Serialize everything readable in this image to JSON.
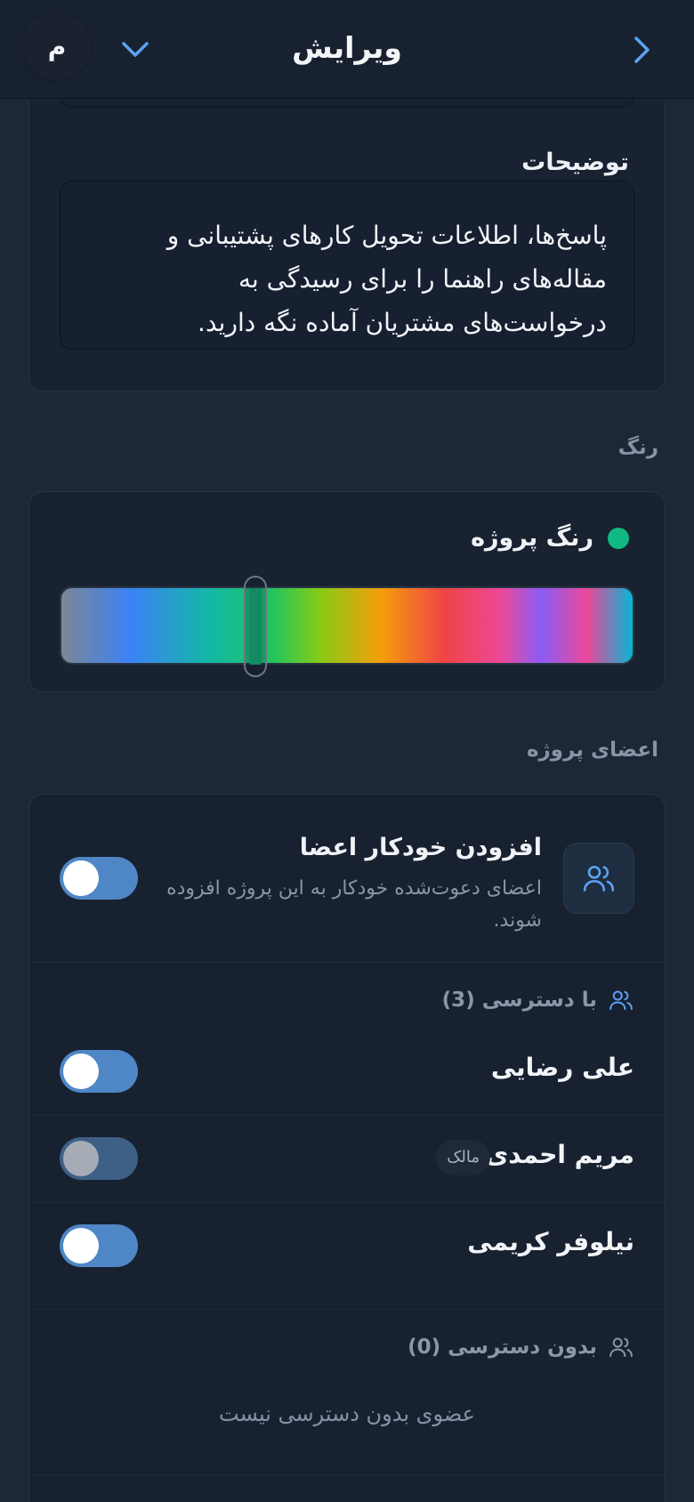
{
  "header": {
    "title": "ویرایش",
    "avatar_initial": "م"
  },
  "description": {
    "label": "توضیحات",
    "lines": [
      "پاسخ‌ها، اطلاعات تحویل کارهای پشتیبانی و",
      "مقاله‌های راهنما را برای رسیدگی به",
      "درخواست‌های مشتریان آماده نگه دارید."
    ]
  },
  "color_section": {
    "label": "رنگ",
    "title": "رنگ پروژه",
    "selected_color": "#10b981"
  },
  "members_section": {
    "label": "اعضای پروژه",
    "auto_add": {
      "title": "افزودن خودکار اعضا",
      "subtitle_lines": [
        "اعضای دعوت‌شده خودکار به این پروژه افزوده",
        "شوند."
      ],
      "enabled": true
    },
    "with_access": {
      "label": "با دسترسی (3)",
      "members": [
        {
          "name": "علی رضایی",
          "badge": "",
          "enabled": true
        },
        {
          "name": "مریم احمدی",
          "badge": "مالک",
          "enabled": true
        },
        {
          "name": "نیلوفر کریمی",
          "badge": "",
          "enabled": true
        }
      ]
    },
    "without_access": {
      "label": "بدون دسترسی (0)",
      "empty_text": "عضوی بدون دسترسی نیست"
    }
  }
}
